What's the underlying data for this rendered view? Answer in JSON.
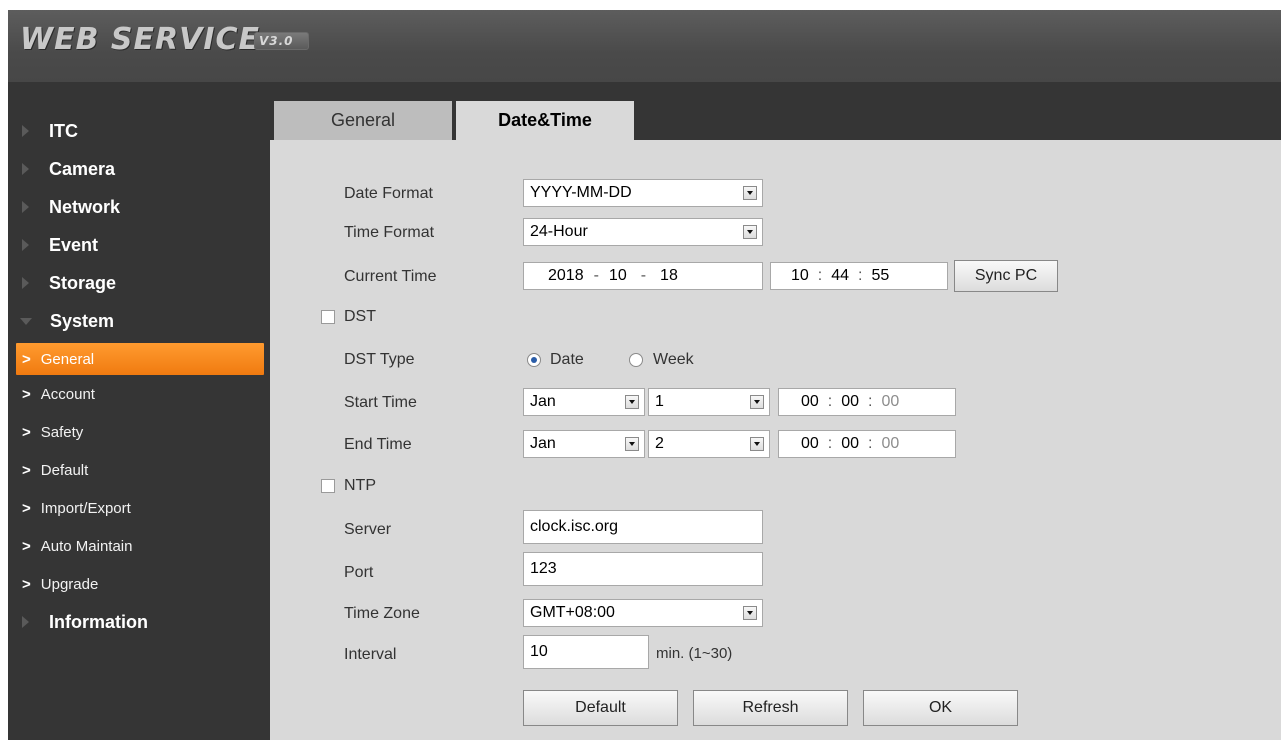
{
  "header": {
    "brand": "WEB  SERVICE",
    "version": "V3.0"
  },
  "sidebar": {
    "items": [
      {
        "label": "ITC"
      },
      {
        "label": "Camera"
      },
      {
        "label": "Network"
      },
      {
        "label": "Event"
      },
      {
        "label": "Storage"
      },
      {
        "label": "System"
      },
      {
        "label": "Information"
      }
    ],
    "chevron": ">",
    "sub_items": [
      {
        "label": "General"
      },
      {
        "label": "Account"
      },
      {
        "label": "Safety"
      },
      {
        "label": "Default"
      },
      {
        "label": "Import/Export"
      },
      {
        "label": "Auto Maintain"
      },
      {
        "label": "Upgrade"
      }
    ]
  },
  "tabs": {
    "general": "General",
    "datetime": "Date&Time"
  },
  "form": {
    "date_format_label": "Date Format",
    "date_format_value": "YYYY-MM-DD",
    "time_format_label": "Time Format",
    "time_format_value": "24-Hour",
    "current_time_label": "Current Time",
    "date": {
      "year": "2018",
      "month": "10",
      "day": "18",
      "sep": "-"
    },
    "time": {
      "hour": "10",
      "minute": "44",
      "second": "55",
      "sep": ":"
    },
    "sync_pc_label": "Sync PC",
    "dst_label": "DST",
    "dst_type_label": "DST Type",
    "dst_type_options": [
      "Date",
      "Week"
    ],
    "start_time_label": "Start Time",
    "start_month": "Jan",
    "start_day": "1",
    "start_time": {
      "hour": "00",
      "minute": "00",
      "second": "00"
    },
    "end_time_label": "End Time",
    "end_month": "Jan",
    "end_day": "2",
    "end_time": {
      "hour": "00",
      "minute": "00",
      "second": "00"
    },
    "ntp_label": "NTP",
    "server_label": "Server",
    "server_value": "clock.isc.org",
    "port_label": "Port",
    "port_value": "123",
    "time_zone_label": "Time Zone",
    "time_zone_value": "GMT+08:00",
    "interval_label": "Interval",
    "interval_value": "10",
    "interval_unit": "min. (1~30)"
  },
  "buttons": {
    "default": "Default",
    "refresh": "Refresh",
    "ok": "OK"
  },
  "colors": {
    "accent": "#f58a1f",
    "sidebar_bg": "#353535",
    "content_bg": "#d9d9d9"
  }
}
